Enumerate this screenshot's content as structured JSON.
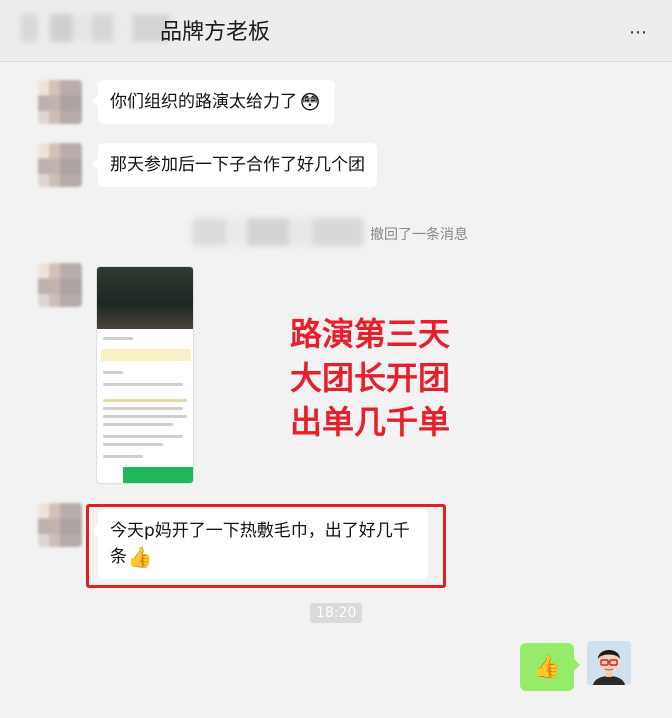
{
  "header": {
    "title": "品牌方老板",
    "more_icon": "⋯"
  },
  "messages": {
    "m1": "你们组织的路演太给力了",
    "m2": "那天参加后一下子合作了好几个团",
    "recall": "撤回了一条消息",
    "m4": "今天p妈开了一下热敷毛巾，出了好几千条"
  },
  "emoji": {
    "surprised": "😳",
    "thumbs_up": "👍"
  },
  "note": {
    "line1": "路演第三天",
    "line2": "大团长开团",
    "line3": "出单几千单",
    "color": "#e6202a"
  },
  "time": "18:20",
  "colors": {
    "my_bubble": "#95ec69",
    "highlight_border": "#e02020"
  }
}
